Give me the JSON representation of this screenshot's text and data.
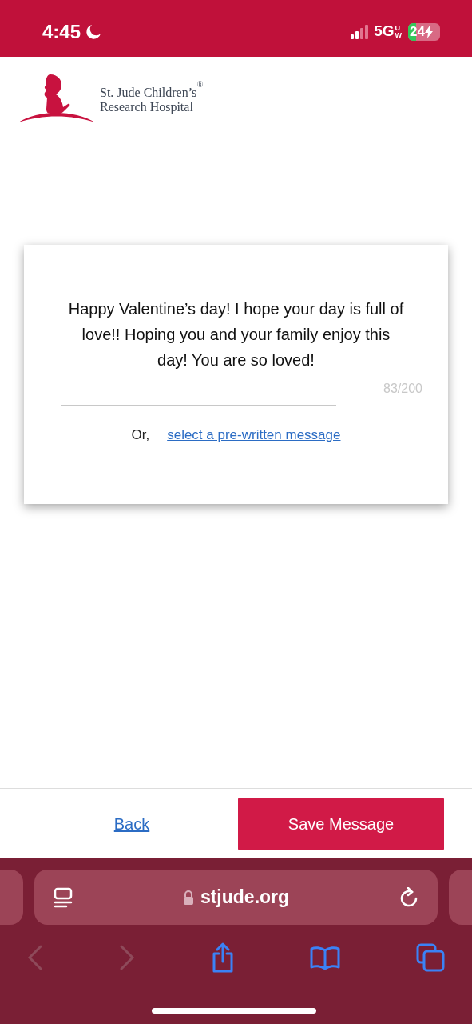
{
  "status_bar": {
    "time": "4:45",
    "network": "5G",
    "network_suffix_top": "U",
    "network_suffix_bottom": "W",
    "battery": "24",
    "charging": true
  },
  "logo": {
    "line_1": "St. Jude Children’s",
    "line_2": "Research Hospital",
    "mark": "®"
  },
  "message_card": {
    "message": "Happy Valentine’s day! I hope your day is full of love!! Hoping you and your family enjoy this day! You are so loved!",
    "counter": "83/200",
    "or_label": "Or,",
    "prewritten_link": "select a pre-written message"
  },
  "footer": {
    "back_link": "Back",
    "save_button": "Save Message"
  },
  "browser": {
    "url": "stjude.org",
    "back_disabled": true,
    "forward_disabled": true
  }
}
